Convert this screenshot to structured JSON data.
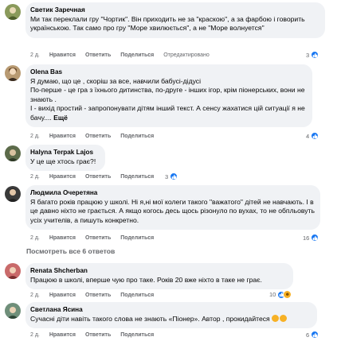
{
  "actions": {
    "like": "Нравится",
    "reply": "Ответить",
    "share": "Поделиться",
    "edited": "Отредактировано"
  },
  "comments": [
    {
      "author": "Светик Заречная",
      "text": "Ми так переклали гру \"Чортик\". Він приходить не за \"краскою\", а за фарбою і говорить українською. Так само про гру \"Море хвилюється\", а не \"Море волнуется\"",
      "time": "2 д.",
      "reactions": "3",
      "edited": true
    },
    {
      "author": "Olena Bas",
      "text": "Я думаю, що це , скоріш за все, навчили бабусі-дідусі\nПо-перше - це гра з їхнього дитинства, по-друге - інших ігор, крім піонерських, вони не знають .\nІ - вихід простий - запропонувати дітям інший текст. А сенсу жахатися цій ситуації я не бачу....",
      "more": "Ещё",
      "time": "2 д.",
      "reactions": "4"
    },
    {
      "author": "Halyna Terpak Lajos",
      "text": "У це ще хтось грає?!",
      "time": "2 д.",
      "reactions": "3"
    },
    {
      "author": "Людмила Очеретяна",
      "text": "Я багато років працюю у школі. Ні я,ні мої колеги такого \"важатого\" дітей не навчають. І в це давно ніхто не грається. А якщо когось десь щось різонуло по вухах, то не обпльовуть усіх учителів, а пишуть конкретно.",
      "time": "2 д.",
      "reactions": "16"
    },
    {
      "author": "Renata Shcherban",
      "text": "Працюю в школі, вперше чую про таке. Років 20 вже ніхто в таке не грає.",
      "time": "2 д.",
      "reactions": "10"
    },
    {
      "author": "Светлана Ясина",
      "text": "Сучасні діти навіть такого слова не знають «Піонер». Автор , прокидайтеся",
      "time": "2 д.",
      "reactions": "6"
    }
  ],
  "more_replies": "Посмотреть все 6 ответов",
  "colors": {
    "bubble": "#f0f2f5",
    "like_blue": "#1877f2",
    "meta_gray": "#65676b"
  }
}
